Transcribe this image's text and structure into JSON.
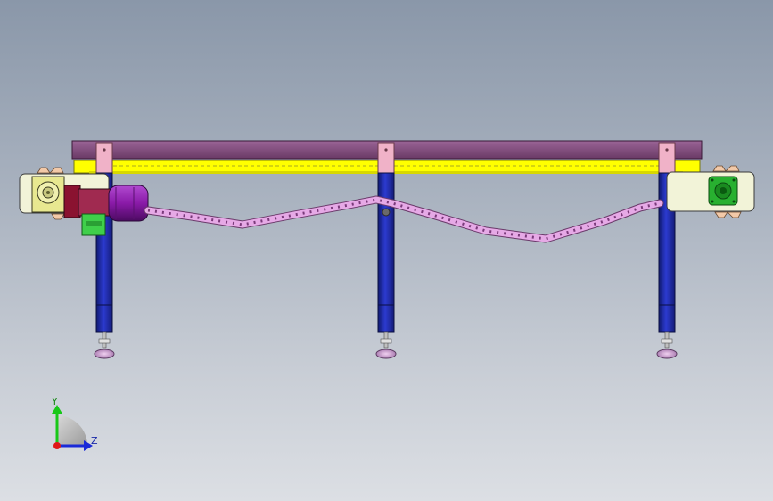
{
  "viewport": {
    "background_top": "#8a97a9",
    "background_bottom": "#dcdfe4"
  },
  "model": {
    "colors": {
      "top_plate": "#7d4a7a",
      "rail": "#ffff00",
      "rail_edge": "#9a9a20",
      "leg": "#1f2a9e",
      "leg_bracket": "#f0b2c8",
      "end_housing": "#f2f3d8",
      "motor": "#8a1aa8",
      "motor_flange": "#8a1230",
      "gearbox": "#3fcf4a",
      "chain": "#e6a9e6",
      "foot": "#d8a6d8",
      "bearing_block": "#28b030",
      "sprocket": "#f2c9a8"
    },
    "icons": [
      "chain-icon",
      "motor-icon",
      "gearbox-icon",
      "sprocket-icon",
      "bearing-icon"
    ]
  },
  "triad": {
    "labels": {
      "y": "Y",
      "z": "Z"
    },
    "colors": {
      "y": "#18c818",
      "z": "#1a2ad8",
      "x": "#e01818"
    }
  }
}
